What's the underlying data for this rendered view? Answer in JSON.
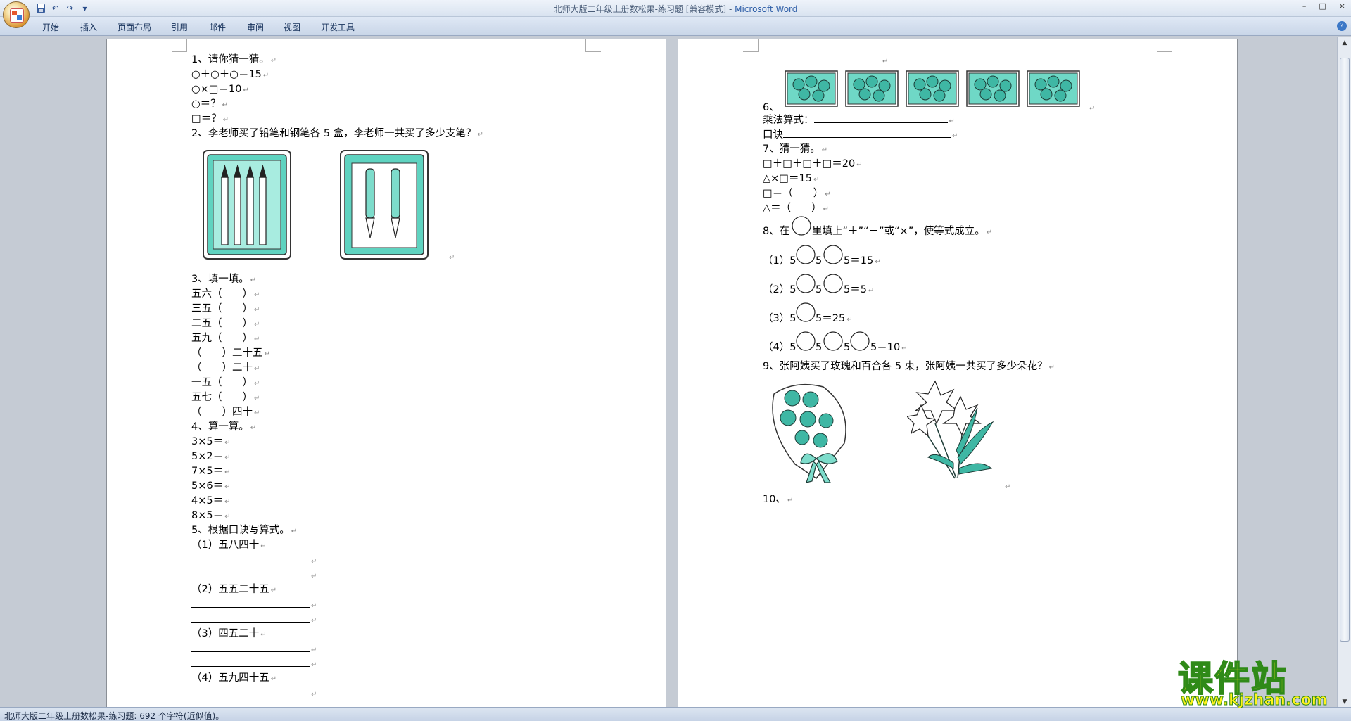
{
  "window": {
    "title": "北师大版二年级上册数松果-练习题 [兼容模式]",
    "app_name": "Microsoft Word",
    "controls": [
      "–",
      "□",
      "×"
    ]
  },
  "ribbon": {
    "tabs": [
      "开始",
      "插入",
      "页面布局",
      "引用",
      "邮件",
      "审阅",
      "视图",
      "开发工具"
    ],
    "help": "?"
  },
  "icons": {
    "office_button": "office-logo-icon",
    "save": "save-icon",
    "undo": "undo-icon",
    "redo": "redo-icon",
    "customize": "chevron-down-icon"
  },
  "colors": {
    "accent": "#2f5fa8",
    "teal": "#3fc8b4",
    "watermark_yellow": "#fff21a",
    "watermark_green": "#2f8a18"
  },
  "page1": {
    "lines": [
      "1、请你猜一猜。",
      "○＋○＋○＝15",
      "○×□＝10",
      "○＝？",
      "□＝？",
      "2、李老师买了铅笔和钢笔各 5 盒，李老师一共买了多少支笔？",
      "3、填一填。",
      "五六（　　）",
      "三五（　　）",
      "二五（　　）",
      "五九（　　）",
      "（　　）二十五",
      "（　　）二十",
      "一五（　　）",
      "五七（　　）",
      "（　　）四十",
      "4、算一算。",
      "3×5＝",
      "5×2＝",
      "7×5＝",
      "5×6＝",
      "4×5＝",
      "8×5＝",
      "5、根据口诀写算式。",
      "（1）五八四十",
      "（2）五五二十五",
      "（3）四五二十",
      "（4）五九四十五"
    ]
  },
  "page2": {
    "lines": [
      "6、",
      "乘法算式：",
      "口诀",
      "7、猜一猜。",
      "□＋□＋□＋□＝20",
      "△×□＝15",
      "□＝（　　）",
      "△＝（　　）",
      "8、在",
      "里填上“＋”“－”或“×”，使等式成立。",
      "（1）5",
      "5",
      "5＝15",
      "（2）5",
      "5",
      "5＝5",
      "（3）5",
      "5＝25",
      "（4）5",
      "5",
      "5",
      "5＝10",
      "9、张阿姨买了玫瑰和百合各 5 束，张阿姨一共买了多少朵花？",
      "10、"
    ]
  },
  "status": {
    "text": "北师大版二年级上册数松果-练习题: 692 个字符(近似值)。"
  },
  "watermark": {
    "title": "课件站",
    "url": "www.kjzhan.com"
  }
}
